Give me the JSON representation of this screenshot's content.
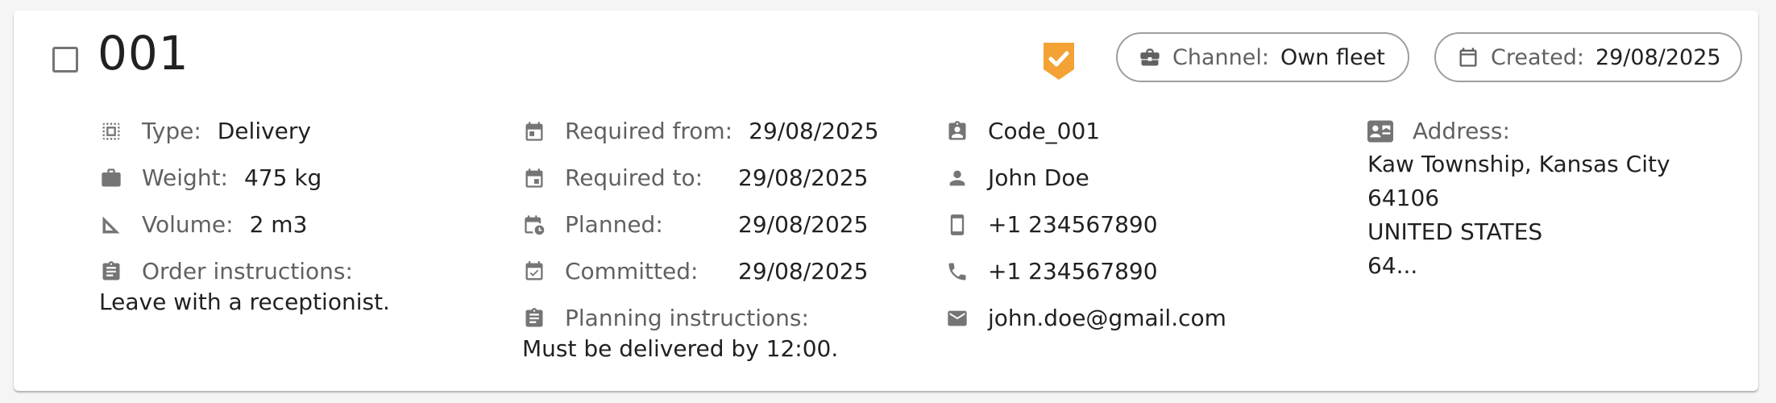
{
  "order": {
    "title": "001",
    "channel": {
      "label": "Channel:",
      "value": "Own fleet"
    },
    "created": {
      "label": "Created:",
      "value": "29/08/2025"
    },
    "badge_color": "#f4a235"
  },
  "details": {
    "type": {
      "label": "Type:",
      "value": "Delivery"
    },
    "weight": {
      "label": "Weight:",
      "value": "475 kg"
    },
    "volume": {
      "label": "Volume:",
      "value": "2 m3"
    },
    "order_instructions": {
      "label": "Order instructions:",
      "value": "Leave with a receptionist."
    }
  },
  "schedule": {
    "required_from": {
      "label": "Required from:",
      "value": "29/08/2025"
    },
    "required_to": {
      "label": "Required to:",
      "value": "29/08/2025"
    },
    "planned": {
      "label": "Planned:",
      "value": "29/08/2025"
    },
    "committed": {
      "label": "Committed:",
      "value": "29/08/2025"
    },
    "planning_instructions": {
      "label": "Planning instructions:",
      "value": "Must be delivered by 12:00."
    }
  },
  "contact": {
    "code": "Code_001",
    "name": "John Doe",
    "mobile": "+1 234567890",
    "phone": "+1 234567890",
    "email": "john.doe@gmail.com"
  },
  "address": {
    "label": "Address:",
    "lines": [
      "Kaw Township, Kansas City",
      "64106",
      "UNITED STATES",
      "64..."
    ]
  },
  "colors": {
    "icon": "#757575",
    "label": "#616161",
    "text": "#212121",
    "chip_border": "#9e9e9e"
  }
}
